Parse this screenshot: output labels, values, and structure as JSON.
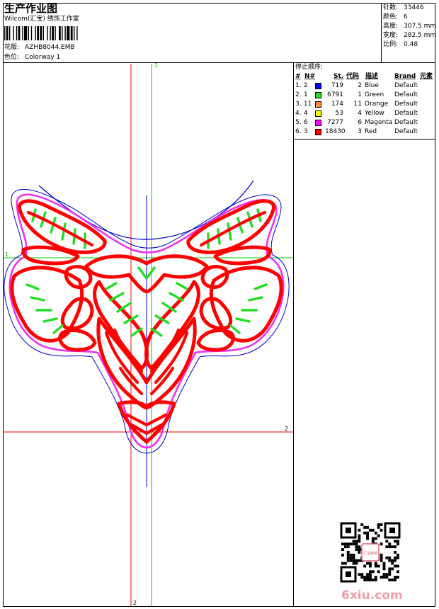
{
  "header": {
    "title": "生产作业图",
    "company": "Wilcom(汇宝) 绣饰工作室",
    "design_label": "花版:",
    "design_value": "AZHB8044.EMB",
    "colorway_label": "色位:",
    "colorway_value": "Colorway 1"
  },
  "stats": {
    "stitches_label": "针数:",
    "stitches_value": "33446",
    "colors_label": "颜色:",
    "colors_value": "6",
    "height_label": "高度:",
    "height_value": "307.5 mm",
    "width_label": "宽度:",
    "width_value": "282.5 mm",
    "scale_label": "比例:",
    "scale_value": "0.48"
  },
  "stop_sequence": {
    "title": "停止顺序:",
    "columns": [
      "#",
      "N#",
      "St.",
      "代码",
      "描述",
      "Brand",
      "元素"
    ],
    "rows": [
      {
        "idx": "1.",
        "n": "2",
        "color": "#0000ff",
        "st": "719",
        "code": "2",
        "desc": "Blue",
        "brand": "Default"
      },
      {
        "idx": "2.",
        "n": "1",
        "color": "#22dd22",
        "st": "6791",
        "code": "1",
        "desc": "Green",
        "brand": "Default"
      },
      {
        "idx": "3.",
        "n": "11",
        "color": "#ff8c3c",
        "st": "174",
        "code": "11",
        "desc": "Orange",
        "brand": "Default"
      },
      {
        "idx": "4.",
        "n": "4",
        "color": "#ffff00",
        "st": "53",
        "code": "4",
        "desc": "Yellow",
        "brand": "Default"
      },
      {
        "idx": "5.",
        "n": "6",
        "color": "#ff00ff",
        "st": "7277",
        "code": "6",
        "desc": "Magenta",
        "brand": "Default"
      },
      {
        "idx": "6.",
        "n": "3",
        "color": "#ff0000",
        "st": "18430",
        "code": "3",
        "desc": "Red",
        "brand": "Default"
      }
    ]
  },
  "guides": {
    "h1_label": "1",
    "v1_label": "1",
    "h2_label": "2",
    "v2_label": "2"
  },
  "watermark": {
    "text": "6xiu.com",
    "qr_seal": "汇宝刺绣"
  },
  "colors": {
    "outline_blue": "#0000cc",
    "guide_green": "#00cc00",
    "guide_red": "#ff0000",
    "fill_green": "#22dd22",
    "satin_red": "#ff0000",
    "border_magenta": "#ee33ee"
  }
}
